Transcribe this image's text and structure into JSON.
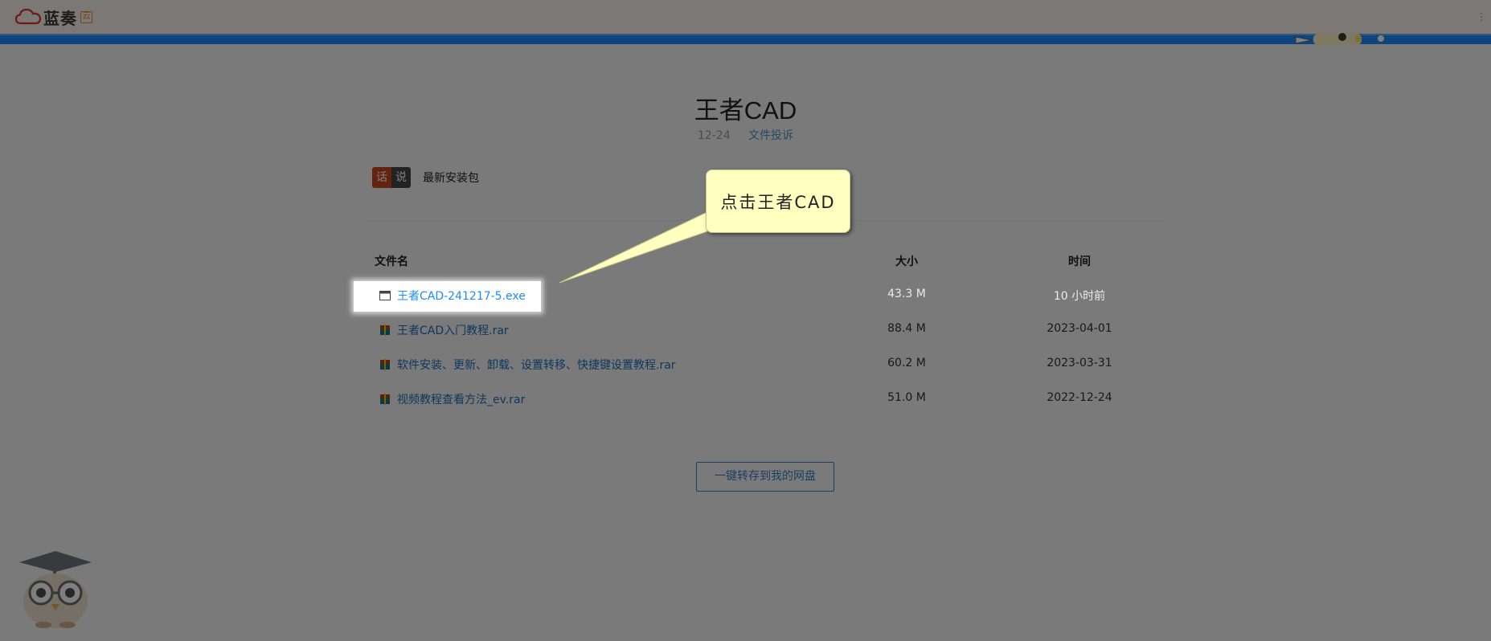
{
  "header": {
    "logo_text": "蓝奏",
    "logo_badge": "云"
  },
  "file": {
    "title": "王者CAD",
    "date": "12-24",
    "report_link": "文件投诉",
    "tag_left": "话",
    "tag_right": "说",
    "description": "最新安装包"
  },
  "table": {
    "headers": {
      "name": "文件名",
      "size": "大小",
      "time": "时间"
    },
    "rows": [
      {
        "name": "王者CAD-241217-5.exe",
        "size": "43.3 M",
        "time": "10 小时前",
        "icon": "exe-window-icon"
      },
      {
        "name": "王者CAD入门教程.rar",
        "size": "88.4 M",
        "time": "2023-04-01",
        "icon": "rar-archive-icon"
      },
      {
        "name": "软件安装、更新、卸载、设置转移、快捷键设置教程.rar",
        "size": "60.2 M",
        "time": "2023-03-31",
        "icon": "rar-archive-icon"
      },
      {
        "name": "视频教程查看方法_ev.rar",
        "size": "51.0 M",
        "time": "2022-12-24",
        "icon": "rar-archive-icon"
      }
    ]
  },
  "save_button": "一键转存到我的网盘",
  "callout": {
    "text": "点击王者CAD"
  },
  "colors": {
    "accent_blue": "#1a8cff",
    "link": "#1f6fb8",
    "callout_bg": "#ffffc0"
  }
}
